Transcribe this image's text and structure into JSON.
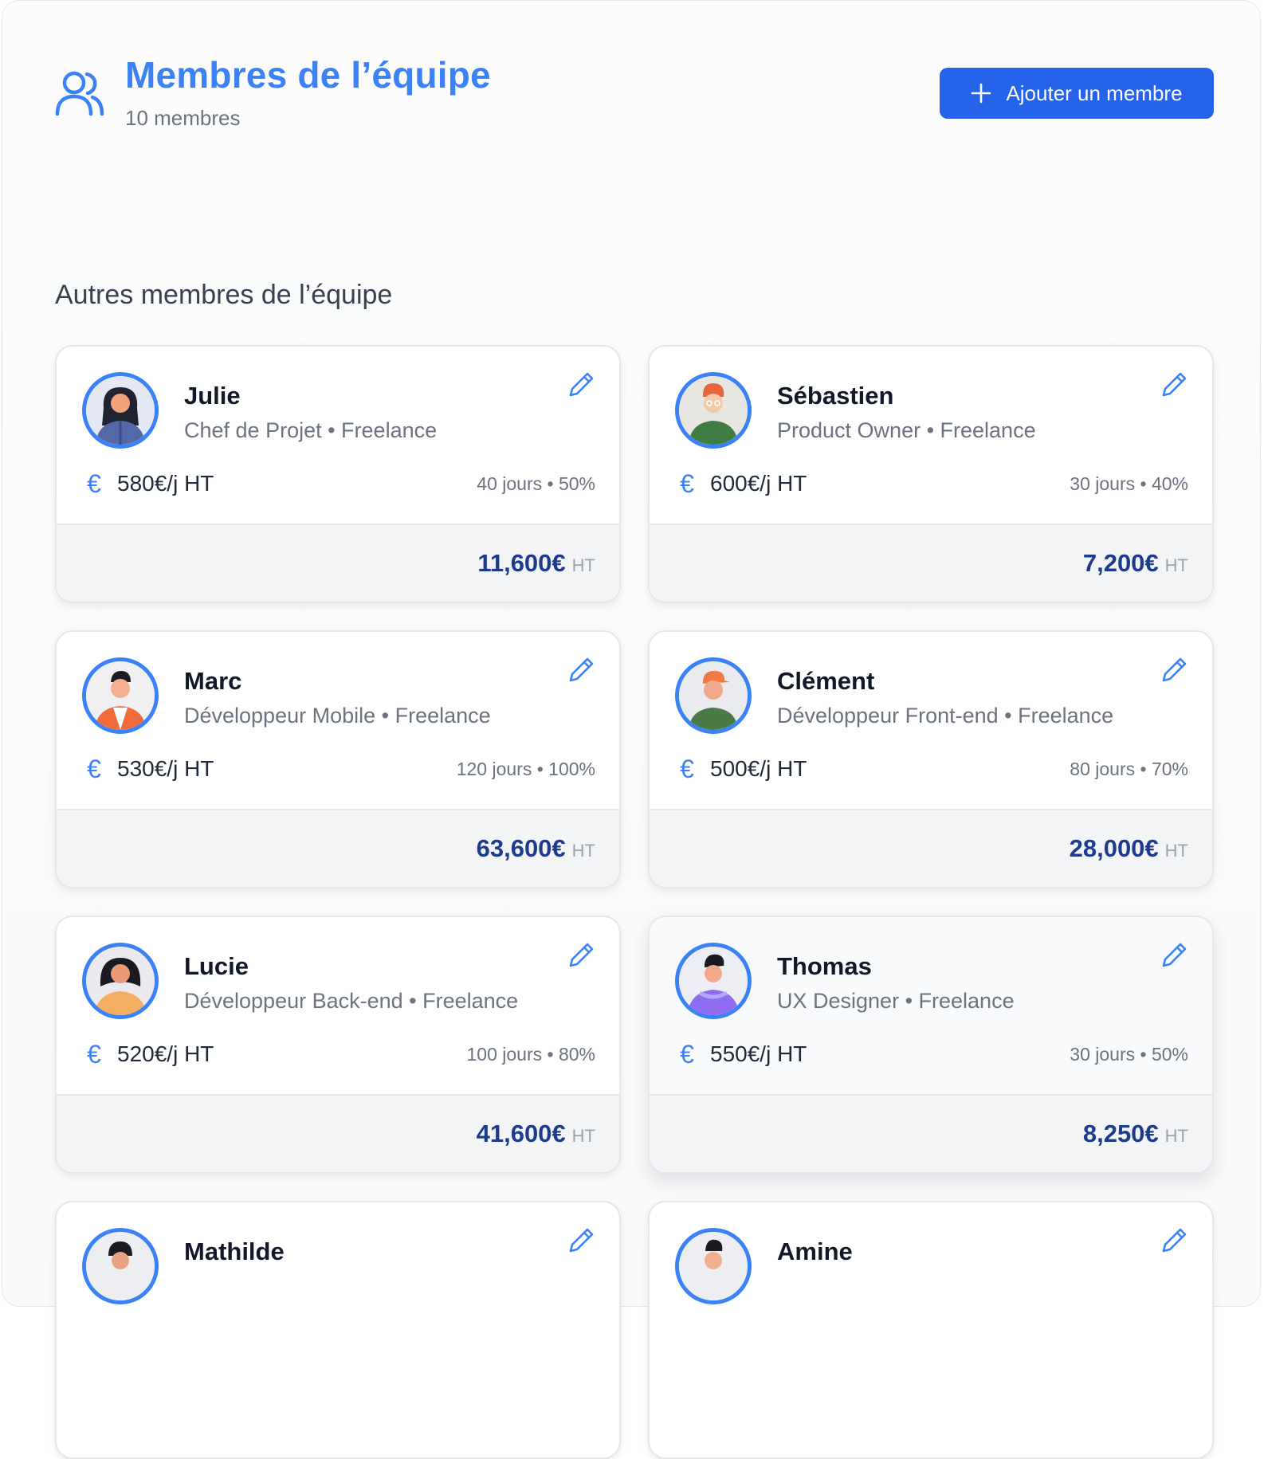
{
  "header": {
    "title": "Membres de l’équipe",
    "subtitle": "10 membres",
    "add_button_label": "Ajouter un membre"
  },
  "section": {
    "title": "Autres membres de l’équipe"
  },
  "colors": {
    "accent": "#3b82f6",
    "button": "#2563eb",
    "total": "#1e3a8a"
  },
  "members": [
    {
      "name": "Julie",
      "role": "Chef de Projet • Freelance",
      "rate": "580€/j HT",
      "meta": "40 jours • 50%",
      "total": "11,600€",
      "total_unit": "HT"
    },
    {
      "name": "Sébastien",
      "role": "Product Owner • Freelance",
      "rate": "600€/j HT",
      "meta": "30 jours • 40%",
      "total": "7,200€",
      "total_unit": "HT"
    },
    {
      "name": "Marc",
      "role": "Développeur Mobile • Freelance",
      "rate": "530€/j HT",
      "meta": "120 jours • 100%",
      "total": "63,600€",
      "total_unit": "HT"
    },
    {
      "name": "Clément",
      "role": "Développeur Front-end • Freelance",
      "rate": "500€/j HT",
      "meta": "80 jours • 70%",
      "total": "28,000€",
      "total_unit": "HT"
    },
    {
      "name": "Lucie",
      "role": "Développeur Back-end • Freelance",
      "rate": "520€/j HT",
      "meta": "100 jours • 80%",
      "total": "41,600€",
      "total_unit": "HT"
    },
    {
      "name": "Thomas",
      "role": "UX Designer • Freelance",
      "rate": "550€/j HT",
      "meta": "30 jours • 50%",
      "total": "8,250€",
      "total_unit": "HT"
    },
    {
      "name": "Mathilde",
      "role": "",
      "rate": "",
      "meta": "",
      "total": "",
      "total_unit": ""
    },
    {
      "name": "Amine",
      "role": "",
      "rate": "",
      "meta": "",
      "total": "",
      "total_unit": ""
    }
  ]
}
